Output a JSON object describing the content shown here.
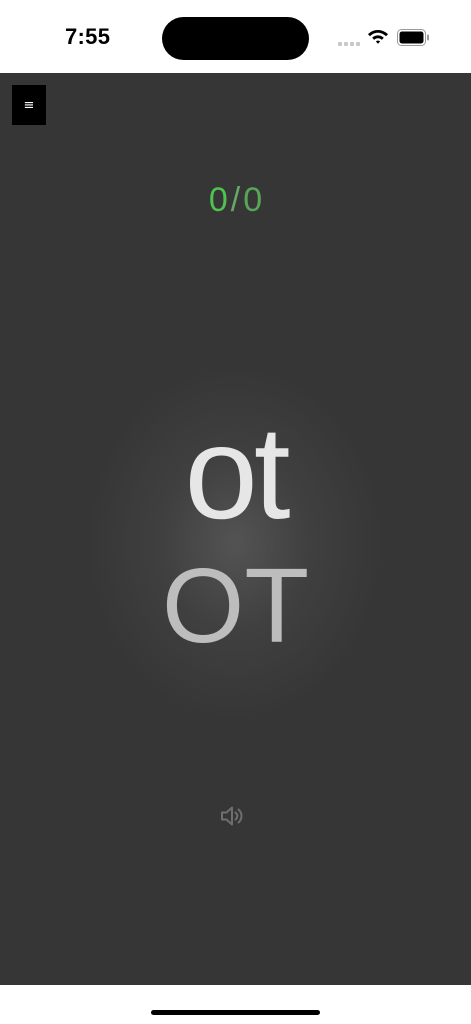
{
  "status_bar": {
    "time": "7:55"
  },
  "toolbar": {
    "menu_label": "≡"
  },
  "score": {
    "correct": "0",
    "separator": "/",
    "total": "0"
  },
  "card": {
    "lowercase": "ot",
    "uppercase": "OT"
  },
  "icons": {
    "menu": "hamburger-icon",
    "speaker": "speaker-icon",
    "wifi": "wifi-icon",
    "battery": "battery-icon",
    "signal": "cell-signal-icon"
  },
  "colors": {
    "background": "#363636",
    "score_correct": "#4fc24f",
    "score_total": "#59a659",
    "word_lower": "#e6e6e6",
    "word_upper": "#bdbdbd"
  }
}
